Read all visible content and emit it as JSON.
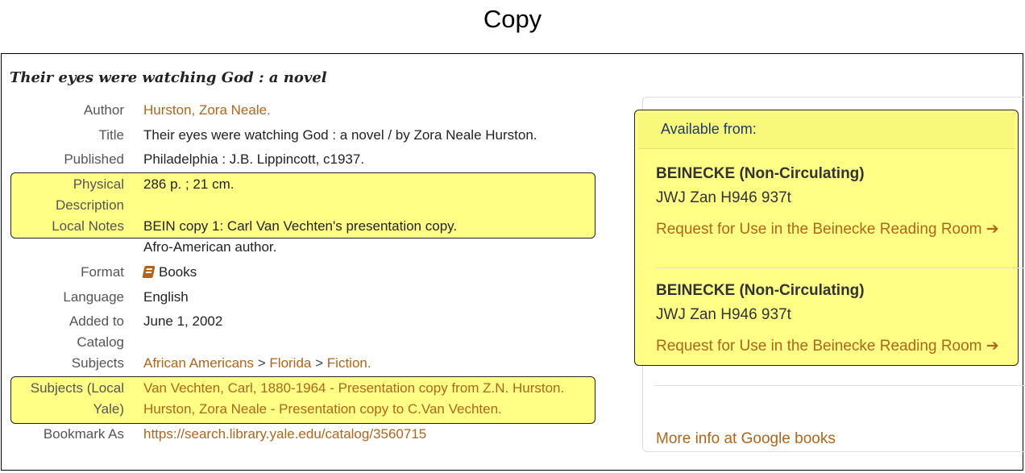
{
  "heading": "Copy",
  "record": {
    "title": "Their eyes were watching God : a novel",
    "fields": {
      "author_label": "Author",
      "author_value": "Hurston, Zora Neale.",
      "title_label": "Title",
      "title_value": "Their eyes were watching God : a novel / by Zora Neale Hurston.",
      "published_label": "Published",
      "published_value": "Philadelphia : J.B. Lippincott, c1937.",
      "physical_label_1": "Physical",
      "physical_label_2": "Description",
      "physical_value": "286 p. ; 21 cm.",
      "notes_label": "Local Notes",
      "notes_value_1": "BEIN copy 1: Carl Van Vechten's presentation copy.",
      "notes_value_2": "Afro-American author.",
      "format_label": "Format",
      "format_icon": "book-icon",
      "format_value": "Books",
      "language_label": "Language",
      "language_value": "English",
      "added_label_1": "Added to",
      "added_label_2": "Catalog",
      "added_value": "June 1, 2002",
      "subjects_label": "Subjects",
      "subjects": [
        "African Americans",
        "Florida",
        "Fiction."
      ],
      "subject_separator": ">",
      "local_label_1": "Subjects (Local",
      "local_label_2": "Yale)",
      "local_subjects": [
        "Van Vechten, Carl, 1880-1964 - Presentation copy from Z.N. Hurston.",
        "Hurston, Zora Neale - Presentation copy to C.Van Vechten."
      ],
      "bookmark_label": "Bookmark As",
      "bookmark_value": "https://search.library.yale.edu/catalog/3560715"
    }
  },
  "availability": {
    "header": "Available from:",
    "items": [
      {
        "location": "BEINECKE (Non-Circulating)",
        "call_number": "JWJ Zan H946 937t",
        "request": "Request for Use in the Beinecke Reading Room",
        "arrow": "➔"
      },
      {
        "location": "BEINECKE (Non-Circulating)",
        "call_number": "JWJ Zan H946 937t",
        "request": "Request for Use in the Beinecke Reading Room",
        "arrow": "➔"
      }
    ],
    "more_info": "More info at Google books"
  },
  "colors": {
    "link": "#b0651a",
    "highlight": "#ffff85",
    "header_blue": "#1f3a6e"
  }
}
